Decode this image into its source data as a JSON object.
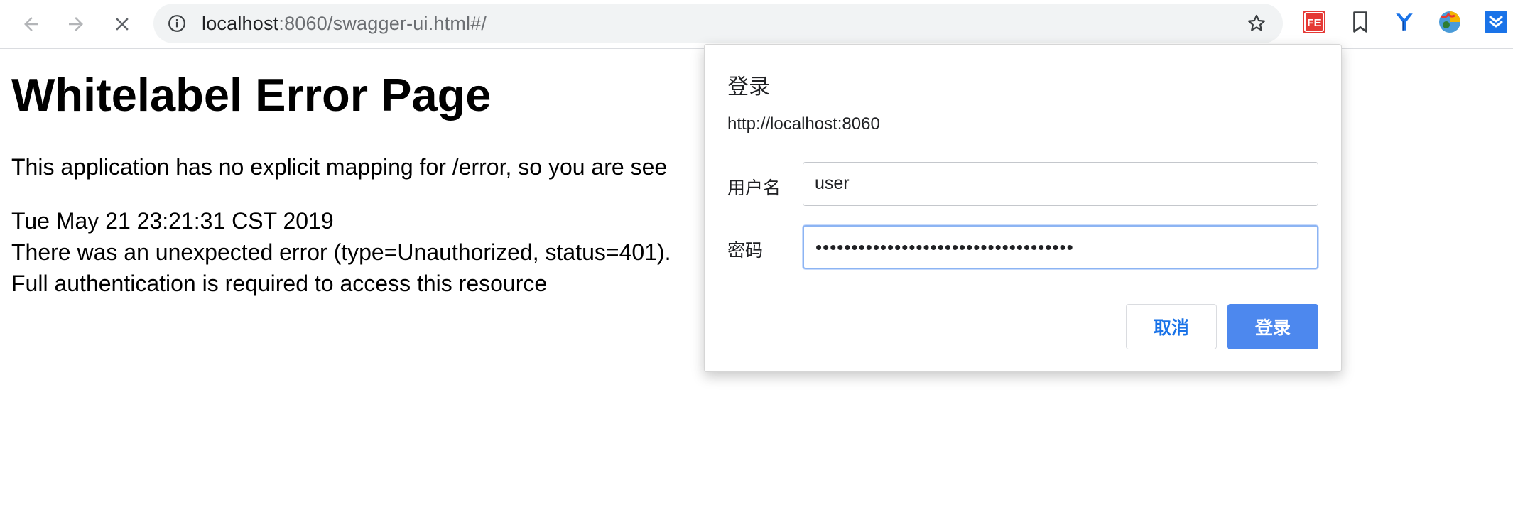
{
  "browser": {
    "url_host": "localhost",
    "url_rest": ":8060/swagger-ui.html#/",
    "icons": {
      "back": "arrow-left-icon",
      "forward": "arrow-right-icon",
      "stop": "close-icon",
      "info": "info-icon",
      "bookmark_star": "star-icon"
    },
    "extensions": [
      {
        "name": "fe-helper-extension-icon",
        "text": "FE",
        "color": "#e53935"
      },
      {
        "name": "bookmark-extension-icon",
        "color": "#5f6368"
      },
      {
        "name": "y-extension-icon",
        "color": "#1a73e8"
      },
      {
        "name": "globe-extension-icon",
        "color": "#4a9bd8"
      },
      {
        "name": "save-extension-icon",
        "color": "#1a73e8"
      }
    ]
  },
  "page": {
    "title": "Whitelabel Error Page",
    "message": "This application has no explicit mapping for /error, so you are see",
    "timestamp": "Tue May 21 23:21:31 CST 2019",
    "error_line": "There was an unexpected error (type=Unauthorized, status=401).",
    "detail": "Full authentication is required to access this resource"
  },
  "dialog": {
    "title": "登录",
    "origin": "http://localhost:8060",
    "username_label": "用户名",
    "username_value": "user",
    "password_label": "密码",
    "password_value": "••••••••••••••••••••••••••••••••••••",
    "cancel_label": "取消",
    "login_label": "登录"
  },
  "colors": {
    "accent": "#4d88ee",
    "link_blue": "#1a73e8",
    "focus_border": "#8cb4f3"
  }
}
